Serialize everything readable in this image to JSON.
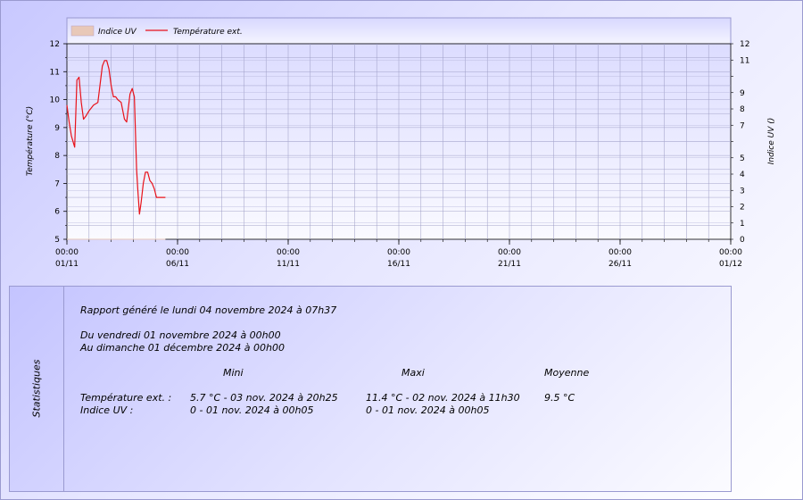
{
  "chart_data": {
    "type": "line",
    "legend": [
      {
        "name": "Indice UV",
        "kind": "area",
        "color": "#e8c8b8"
      },
      {
        "name": "Température ext.",
        "kind": "line",
        "color": "#e8121a"
      }
    ],
    "legend_placement": "top-left",
    "ylabel_left": "Température (°C)",
    "ylabel_right": "Indice UV ()",
    "ylim_left": [
      5,
      12
    ],
    "ylim_right": [
      0,
      12
    ],
    "yticks_left": [
      5,
      6,
      7,
      8,
      9,
      10,
      11,
      12
    ],
    "yticks_right": [
      0,
      1,
      2,
      3,
      4,
      5,
      7,
      8,
      9,
      11,
      12
    ],
    "xlim_days": [
      0,
      30
    ],
    "xticks": [
      {
        "day": 0,
        "time": "00:00",
        "date": "01/11"
      },
      {
        "day": 5,
        "time": "00:00",
        "date": "06/11"
      },
      {
        "day": 10,
        "time": "00:00",
        "date": "11/11"
      },
      {
        "day": 15,
        "time": "00:00",
        "date": "16/11"
      },
      {
        "day": 20,
        "time": "00:00",
        "date": "21/11"
      },
      {
        "day": 25,
        "time": "00:00",
        "date": "26/11"
      },
      {
        "day": 30,
        "time": "00:00",
        "date": "01/12"
      }
    ],
    "grid": true,
    "series": [
      {
        "name": "Température ext.",
        "color": "#e8121a",
        "x_days": [
          0,
          0.1,
          0.2,
          0.35,
          0.45,
          0.55,
          0.65,
          0.75,
          0.85,
          1.0,
          1.2,
          1.4,
          1.6,
          1.7,
          1.8,
          1.9,
          2.0,
          2.1,
          2.2,
          2.3,
          2.45,
          2.6,
          2.7,
          2.85,
          2.95,
          3.05,
          3.15,
          3.2,
          3.28,
          3.35,
          3.45,
          3.55,
          3.65,
          3.75,
          3.85,
          3.95,
          4.05,
          4.15,
          4.25,
          4.35,
          4.45
        ],
        "values": [
          9.8,
          9.2,
          8.7,
          8.3,
          10.7,
          10.8,
          9.9,
          9.3,
          9.4,
          9.6,
          9.8,
          9.9,
          11.2,
          11.4,
          11.4,
          11.1,
          10.5,
          10.1,
          10.1,
          10.0,
          9.9,
          9.3,
          9.2,
          10.2,
          10.4,
          10.1,
          7.5,
          6.8,
          5.9,
          6.3,
          7.0,
          7.4,
          7.4,
          7.1,
          7.0,
          6.8,
          6.5,
          6.5,
          6.5,
          6.5,
          6.5
        ]
      },
      {
        "name": "Indice UV",
        "color": "#e8c8b8",
        "x_days": [
          0,
          4.45
        ],
        "values": [
          0,
          0
        ]
      }
    ]
  },
  "stats": {
    "side_label": "Statistiques",
    "generated": "Rapport généré le lundi 04 novembre 2024 à 07h37",
    "from": "Du vendredi 01 novembre 2024 à 00h00",
    "to": "Au dimanche 01 décembre 2024 à 00h00",
    "headers": {
      "min": "Mini",
      "max": "Maxi",
      "avg": "Moyenne"
    },
    "rows": [
      {
        "label": "Température ext. :",
        "min": "5.7 °C - 03 nov. 2024 à 20h25",
        "max": "11.4 °C - 02 nov. 2024 à 11h30",
        "avg": "9.5 °C"
      },
      {
        "label": "Indice UV :",
        "min": "0 - 01 nov. 2024 à 00h05",
        "max": "0 - 01 nov. 2024 à 00h05",
        "avg": ""
      }
    ]
  }
}
